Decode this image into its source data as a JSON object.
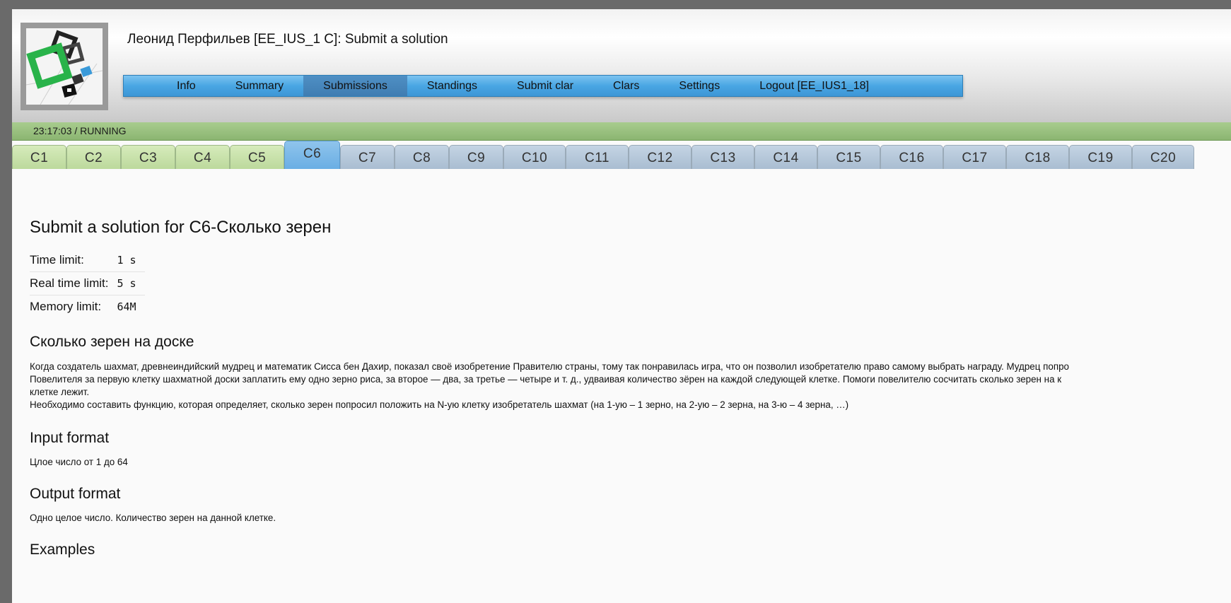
{
  "header": {
    "title": "Леонид Перфильев [EE_IUS_1 C]: Submit a solution"
  },
  "menu": {
    "items": [
      {
        "label": "Info",
        "active": false
      },
      {
        "label": "Summary",
        "active": false
      },
      {
        "label": "Submissions",
        "active": true
      },
      {
        "label": "Standings",
        "active": false
      },
      {
        "label": "Submit clar",
        "active": false
      },
      {
        "label": "Clars",
        "active": false
      },
      {
        "label": "Settings",
        "active": false
      },
      {
        "label": "Logout [EE_IUS1_18]",
        "active": false
      }
    ]
  },
  "status": {
    "time": "23:17:03",
    "separator": " / ",
    "state": "RUNNING"
  },
  "tabs": [
    "C1",
    "C2",
    "C3",
    "C4",
    "C5",
    "C6",
    "C7",
    "C8",
    "C9",
    "C10",
    "C11",
    "C12",
    "C13",
    "C14",
    "C15",
    "C16",
    "C17",
    "C18",
    "C19",
    "C20"
  ],
  "problem": {
    "heading": "Submit a solution for C6-Сколько зерен",
    "limits": [
      {
        "label": "Time limit:",
        "value": "1 s"
      },
      {
        "label": "Real time limit:",
        "value": "5 s"
      },
      {
        "label": "Memory limit:",
        "value": "64M"
      }
    ],
    "statement_title": "Сколько зерен на доске",
    "statement_lines": [
      "Когда создатель шахмат, древнеиндийский мудрец и математик Сисса бен Дахир, показал своё изобретение Правителю страны, тому так понравилась игра, что он позволил изобретателю право самому выбрать награду. Мудрец попро",
      "Повелителя за первую клетку шахматной доски заплатить ему одно зерно риса, за второе — два, за третье — четыре и т. д., удваивая количество зёрен на каждой следующей клетке. Помоги повелителю сосчитать сколько зерен на к",
      "клетке лежит.",
      "Необходимо составить функцию, которая определяет, сколько зерен попросил положить на N-ую клетку изобретатель шахмат (на 1-ую – 1 зерно, на 2-ую – 2 зерна, на 3-ю – 4 зерна, …)"
    ],
    "input_title": "Input format",
    "input_text": "Цлое число от 1 до 64",
    "output_title": "Output format",
    "output_text": "Одно целое число. Количество зерен на данной клетке.",
    "examples_title": "Examples"
  },
  "colors": {
    "menu_blue": "#49a6e3",
    "status_green": "#9fc586",
    "tab_done_green": "#c9e2a9",
    "tab_active_blue": "#7ab8e8",
    "tab_default": "#b4c6d8"
  }
}
